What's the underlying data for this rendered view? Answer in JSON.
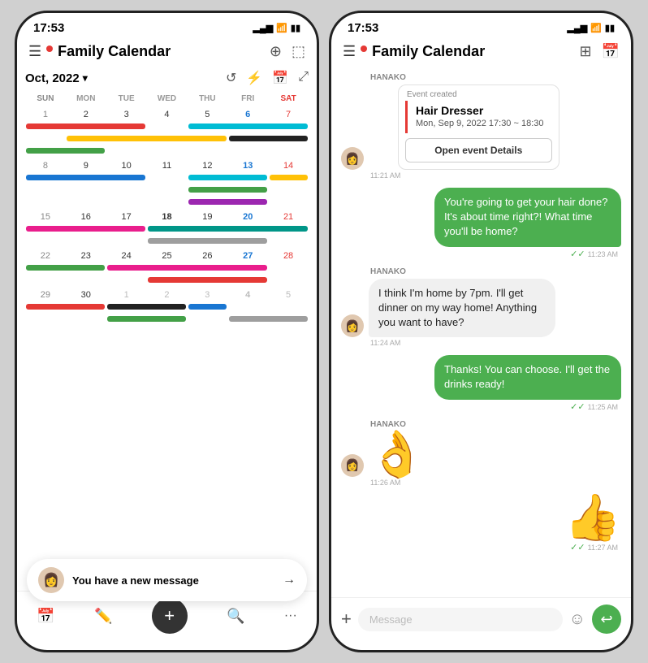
{
  "phone1": {
    "status": {
      "time": "17:53",
      "signal": "▂▄▆",
      "wifi": "WiFi",
      "battery": "🔋"
    },
    "header": {
      "title": "Family Calendar",
      "menu_icon": "☰",
      "actions": [
        "⭐",
        "⬛"
      ]
    },
    "month_nav": {
      "label": "Oct, 2022",
      "chevron": "▾"
    },
    "days_header": [
      "SUN",
      "MON",
      "TUE",
      "WED",
      "THU",
      "FRI",
      "SAT"
    ],
    "weeks": [
      {
        "days": [
          "1",
          "2",
          "3",
          "4",
          "5",
          "6",
          "7"
        ],
        "types": [
          "sun",
          "",
          "",
          "today",
          "",
          "blue",
          "sat"
        ]
      },
      {
        "days": [
          "8",
          "9",
          "10",
          "11",
          "12",
          "13",
          "14"
        ],
        "types": [
          "sun",
          "",
          "",
          "",
          "",
          "blue",
          "sat"
        ]
      },
      {
        "days": [
          "15",
          "16",
          "17",
          "18",
          "19",
          "20",
          "21"
        ],
        "types": [
          "sun",
          "",
          "",
          "bold",
          "",
          "blue",
          "sat"
        ]
      },
      {
        "days": [
          "22",
          "23",
          "24",
          "25",
          "26",
          "27",
          "28"
        ],
        "types": [
          "sun",
          "",
          "",
          "",
          "",
          "blue",
          "sat"
        ]
      },
      {
        "days": [
          "29",
          "30",
          "1",
          "2",
          "3",
          "4",
          "5"
        ],
        "types": [
          "sun",
          "",
          "gray",
          "gray",
          "gray",
          "blue gray",
          "sat gray"
        ]
      }
    ],
    "notification": {
      "text": "You have a new message",
      "arrow": "→"
    },
    "tabs": [
      "📅",
      "✏️",
      "+",
      "🔍",
      "···"
    ]
  },
  "phone2": {
    "status": {
      "time": "17:53"
    },
    "header": {
      "title": "Family Calendar",
      "menu_icon": "☰",
      "actions": [
        "📋",
        "📅"
      ]
    },
    "chat": {
      "messages": [
        {
          "type": "event-card",
          "sender": "HANAKO",
          "header": "Event created",
          "event_title": "Hair Dresser",
          "event_time": "Mon, Sep 9, 2022 17:30 ~ 18:30",
          "button_label": "Open event Details",
          "time": "11:21 AM"
        },
        {
          "type": "outgoing",
          "text": "You're going to get your hair done? It's about time right?! What time you'll be home?",
          "time": "11:23 AM"
        },
        {
          "type": "incoming",
          "sender": "HANAKO",
          "text": "I think I'm home by 7pm. I'll get dinner on my way home! Anything you want to have?",
          "time": "11:24 AM"
        },
        {
          "type": "outgoing",
          "text": "Thanks! You can choose. I'll get the drinks ready!",
          "time": "11:25 AM"
        },
        {
          "type": "incoming",
          "sender": "HANAKO",
          "emoji": "👌",
          "time": "11:26 AM"
        },
        {
          "type": "outgoing",
          "emoji": "👍",
          "time": "11:27 AM"
        }
      ]
    },
    "input_bar": {
      "placeholder": "Message",
      "plus_icon": "+",
      "emoji_icon": "☺",
      "send_icon": "↩"
    }
  }
}
